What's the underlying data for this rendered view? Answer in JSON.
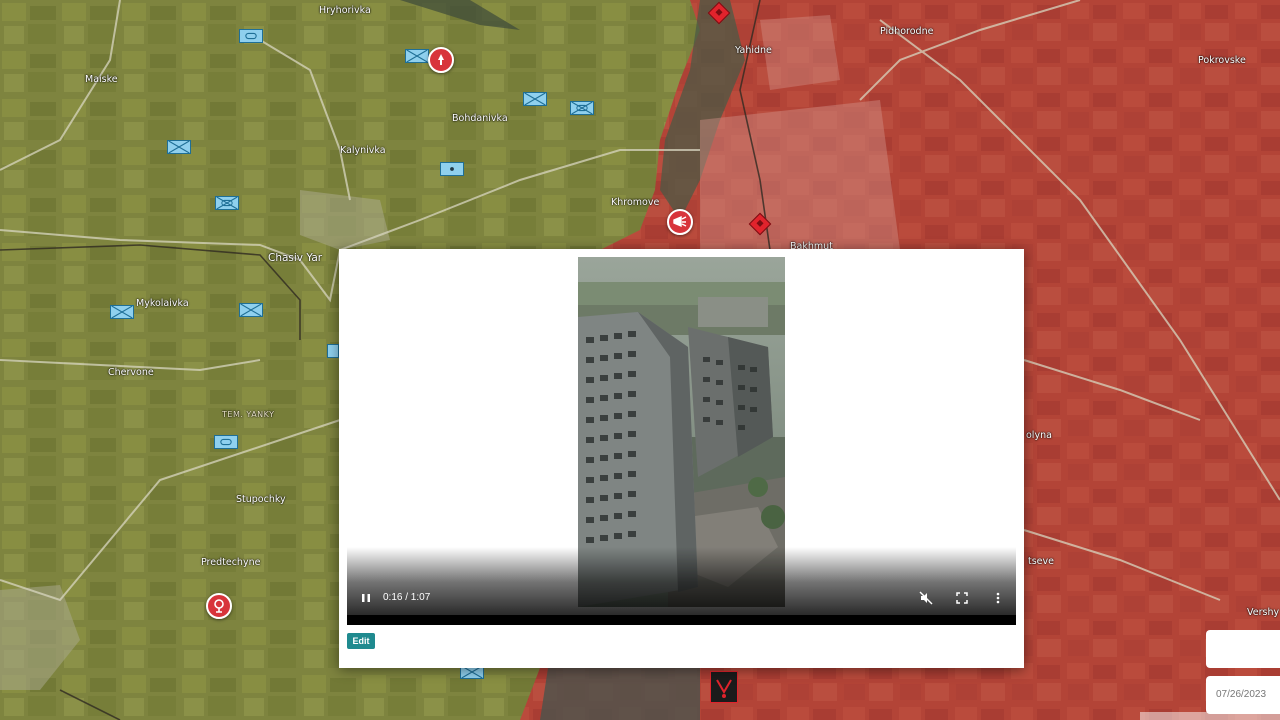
{
  "map": {
    "places": [
      {
        "name": "Hryhorivka"
      },
      {
        "name": "Maiske"
      },
      {
        "name": "Bohdanivka"
      },
      {
        "name": "Kalynivka"
      },
      {
        "name": "Chasiv Yar"
      },
      {
        "name": "Mykolaivka"
      },
      {
        "name": "Chervone"
      },
      {
        "name": "TEM. YANKY"
      },
      {
        "name": "Stupochky"
      },
      {
        "name": "Predtechyne"
      },
      {
        "name": "Yahidne"
      },
      {
        "name": "Pidhorodne"
      },
      {
        "name": "Pokrovske"
      },
      {
        "name": "Khromove"
      },
      {
        "name": "Bakhmut"
      },
      {
        "name": "olyna"
      },
      {
        "name": "tseve"
      },
      {
        "name": "Vershy"
      }
    ],
    "colors": {
      "occupied": "#b8463c",
      "contested": "#6e3a2e",
      "unit_fill": "#8fd0ee",
      "marker_red": "#d8343b"
    },
    "icons": [
      "ukrainian-unit-icon",
      "artillery-strike-icon",
      "russian-unit-icon",
      "explosion-icon",
      "shelling-icon"
    ]
  },
  "video_modal": {
    "close_icon": "close-icon",
    "time_display": "0:16 / 1:07",
    "progress_fraction": 0.25,
    "buffered_fraction": 0.66,
    "controls": {
      "play_pause_icon": "pause-icon",
      "mute_icon": "muted-volume-icon",
      "fullscreen_icon": "fullscreen-icon",
      "more_icon": "more-vertical-icon"
    },
    "edit_label": "Edit"
  },
  "date_panel": {
    "date": "07/26/2023"
  }
}
